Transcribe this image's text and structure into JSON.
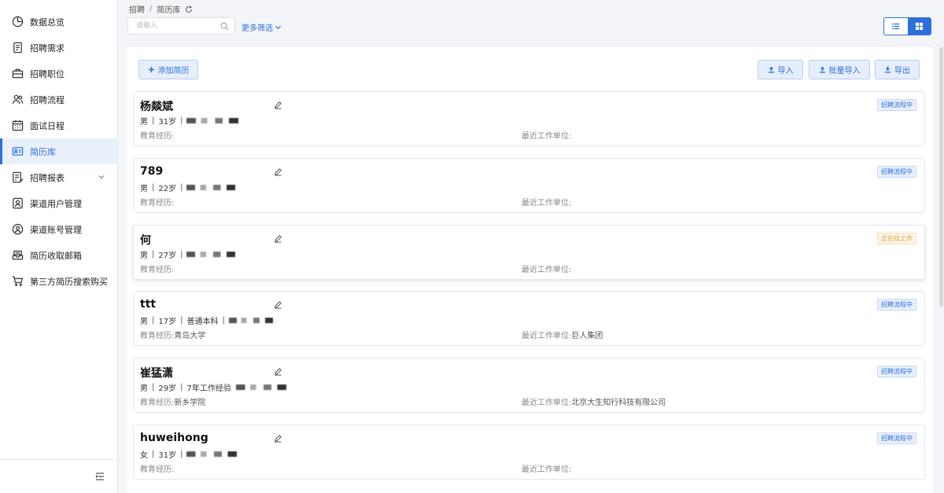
{
  "breadcrumb": {
    "root": "招聘",
    "separator": "/",
    "current": "简历库"
  },
  "search": {
    "placeholder": "请输入",
    "value": ""
  },
  "filter": {
    "more_label": "更多筛选"
  },
  "sidebar": {
    "items": [
      {
        "label": "数据总览",
        "icon": "pie-chart-icon"
      },
      {
        "label": "招聘需求",
        "icon": "document-icon"
      },
      {
        "label": "招聘职位",
        "icon": "briefcase-icon"
      },
      {
        "label": "招聘流程",
        "icon": "users-icon"
      },
      {
        "label": "面试日程",
        "icon": "calendar-icon"
      },
      {
        "label": "简历库",
        "icon": "id-card-icon",
        "active": true
      },
      {
        "label": "招聘报表",
        "icon": "report-icon"
      },
      {
        "label": "渠道用户管理",
        "icon": "user-box-icon"
      },
      {
        "label": "渠道账号管理",
        "icon": "user-circle-icon"
      },
      {
        "label": "简历收取邮箱",
        "icon": "inbox-icon"
      },
      {
        "label": "第三方简历搜索购买",
        "icon": "cart-icon"
      }
    ]
  },
  "toolbar": {
    "add_label": "添加简历",
    "import_label": "导入",
    "batch_import_label": "批量导入",
    "export_label": "导出"
  },
  "labels": {
    "education": "教育经历:",
    "work": "最近工作单位:"
  },
  "resumes": [
    {
      "name": "杨燚斌",
      "gender": "男",
      "age": "31岁",
      "extra": "",
      "education": "",
      "work": "",
      "status": "招聘流程中",
      "status_type": "blue"
    },
    {
      "name": "789",
      "gender": "男",
      "age": "22岁",
      "extra": "",
      "education": "",
      "work": "",
      "status": "招聘流程中",
      "status_type": "blue"
    },
    {
      "name": "何",
      "gender": "男",
      "age": "27岁",
      "extra": "",
      "education": "",
      "work": "",
      "status": "正在找工作",
      "status_type": "orange"
    },
    {
      "name": "ttt",
      "gender": "男",
      "age": "17岁",
      "extra": "普通本科",
      "education": "青岛大学",
      "work": "巨人集团",
      "status": "招聘流程中",
      "status_type": "blue"
    },
    {
      "name": "崔猛潇",
      "gender": "男",
      "age": "29岁",
      "extra": "7年工作经验",
      "education": "新乡学院",
      "work": "北京大生知行科技有限公司",
      "status": "招聘流程中",
      "status_type": "blue"
    },
    {
      "name": "huweihong",
      "gender": "女",
      "age": "31岁",
      "extra": "",
      "education": "",
      "work": "",
      "status": "招聘流程中",
      "status_type": "blue"
    }
  ],
  "colors": {
    "accent": "#2f6fdc",
    "status_blue": "#2f6fdc",
    "status_orange": "#e6a23c"
  }
}
